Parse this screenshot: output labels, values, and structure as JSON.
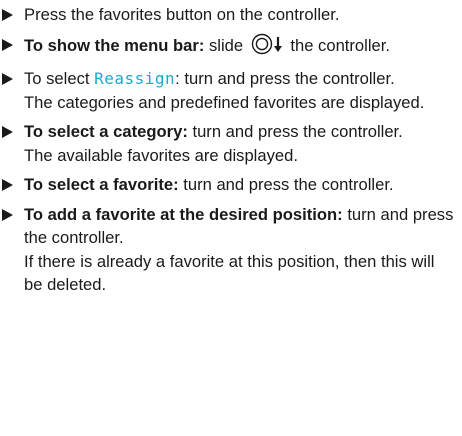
{
  "steps": [
    {
      "text": "Press the favorites button on the controller."
    },
    {
      "lead": "To show the menu bar:",
      "text_before_icon": " slide ",
      "icon": "controller-slide-down-icon",
      "text_after_icon": " the controller."
    },
    {
      "text_before": "To select ",
      "highlight": "Reassign",
      "text_after": ": turn and press the controller.",
      "result": "The categories and predefined favorites are displayed."
    },
    {
      "lead": "To select a category:",
      "text": " turn and press the controller.",
      "result": "The available favorites are displayed."
    },
    {
      "lead": "To select a favorite:",
      "text": " turn and press the controller."
    },
    {
      "lead": "To add a favorite at the desired position:",
      "text": " turn and press the controller.",
      "result": "If there is already a favorite at this position, then this will be deleted."
    }
  ],
  "colors": {
    "text": "#1a1a1a",
    "highlight": "#1aa8d8",
    "background": "#ffffff"
  }
}
